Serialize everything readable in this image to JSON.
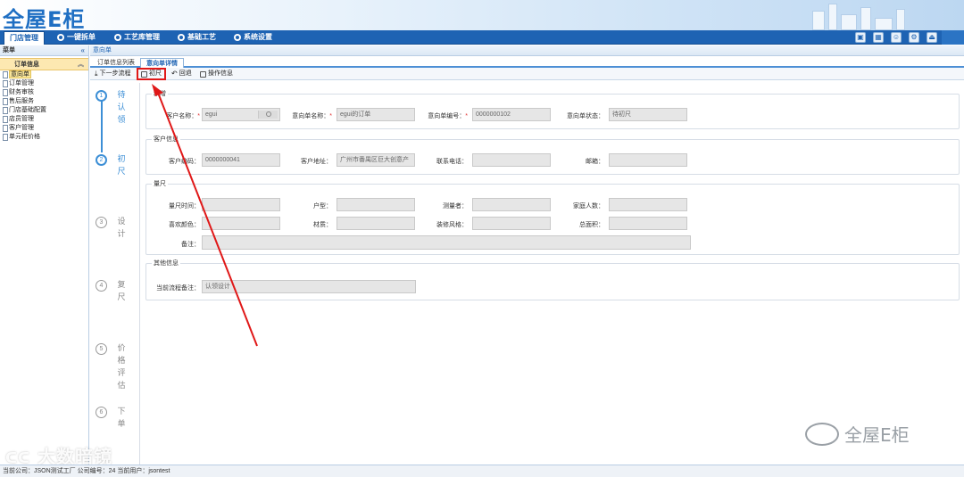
{
  "app": {
    "logo_text": "全屋E柜"
  },
  "nav": {
    "items": [
      {
        "label": "门店管理",
        "active": true
      },
      {
        "label": "一键拆单"
      },
      {
        "label": "工艺库管理"
      },
      {
        "label": "基础工艺"
      },
      {
        "label": "系统设置"
      }
    ],
    "tools": [
      "screen-icon",
      "calendar-icon",
      "user-icon",
      "gear-icon",
      "exit-icon"
    ]
  },
  "sidebar": {
    "title": "菜单",
    "group": "订单信息",
    "items": [
      {
        "label": "意向单",
        "active": true
      },
      {
        "label": "订单管理"
      },
      {
        "label": "财务审核"
      },
      {
        "label": "售后服务"
      },
      {
        "label": "门店基础配置"
      },
      {
        "label": "店员管理"
      },
      {
        "label": "客户管理"
      },
      {
        "label": "单元柜价格"
      }
    ]
  },
  "content": {
    "title": "意向单",
    "subtabs": [
      {
        "label": "订单信息列表"
      },
      {
        "label": "意向单详情",
        "active": true
      }
    ],
    "toolbar": {
      "next_step": "下一步流程",
      "measure": "初尺",
      "back": "回退",
      "operation_info": "操作信息"
    }
  },
  "steps": [
    {
      "num": "1",
      "label": "待认领",
      "done": true
    },
    {
      "num": "2",
      "label": "初尺",
      "done": true
    },
    {
      "num": "3",
      "label": "设计"
    },
    {
      "num": "4",
      "label": "复尺"
    },
    {
      "num": "5",
      "label": "价格评估"
    },
    {
      "num": "6",
      "label": "下单"
    }
  ],
  "form": {
    "basic": {
      "legend": "新增",
      "customer_name_label": "客户名称：",
      "customer_name_value": "egui",
      "order_name_label": "意向单名称：",
      "order_name_value": "egui的订单",
      "order_no_label": "意向单编号：",
      "order_no_value": "0000000102",
      "status_label": "意向单状态：",
      "status_value": "待初尺"
    },
    "customer": {
      "legend": "客户信息",
      "code_label": "客户编码：",
      "code_value": "0000000041",
      "address_label": "客户地址：",
      "address_value": "广州市番禺区巨大创意产",
      "phone_label": "联系电话：",
      "phone_value": "",
      "email_label": "邮箱：",
      "email_value": ""
    },
    "measure": {
      "legend": "量尺",
      "time_label": "量尺时间：",
      "house_type_label": "户型：",
      "measurer_label": "测量者：",
      "family_label": "家庭人数：",
      "color_label": "喜欢颜色：",
      "material_label": "材质：",
      "style_label": "装修风格：",
      "area_label": "总面积：",
      "remark_label": "备注："
    },
    "other": {
      "legend": "其他信息",
      "flow_remark_label": "当前流程备注：",
      "flow_remark_value": "认领设计"
    }
  },
  "watermarks": {
    "left": "大数暗镜",
    "right": "全屋E柜"
  },
  "statusbar": {
    "text": "当前公司：JSON测试工厂    公司编号：24    当前用户：jsontest"
  }
}
